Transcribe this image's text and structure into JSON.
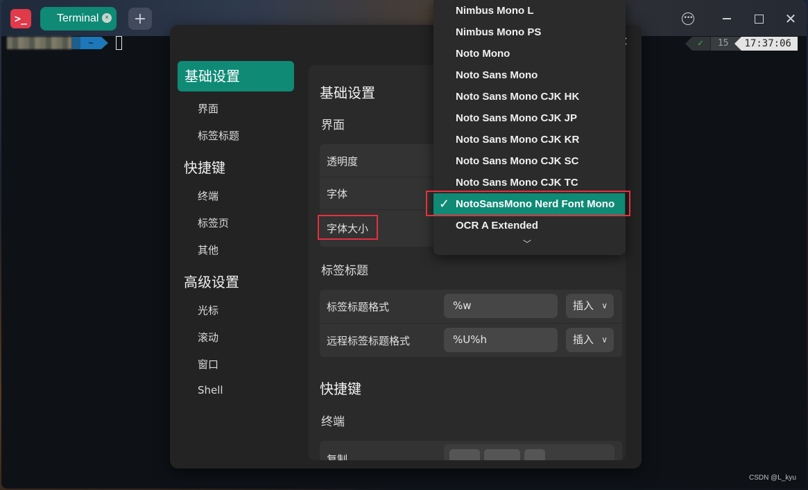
{
  "titlebar": {
    "app_icon_glyph": ">_",
    "tab_label": "Terminal",
    "tab_close": "×",
    "new_tab": "+",
    "menu_glyph": "•••",
    "close_glyph": "✕"
  },
  "terminal": {
    "dir_glyph": "~",
    "status_check": "✓",
    "history_number": "15",
    "time": "17:37:06"
  },
  "dialog": {
    "close_glyph": "✕",
    "sidebar": {
      "groups": [
        {
          "label": "基础设置",
          "items": [
            "界面",
            "标签标题"
          ]
        },
        {
          "label": "快捷键",
          "items": [
            "终端",
            "标签页",
            "其他"
          ]
        },
        {
          "label": "高级设置",
          "items": [
            "光标",
            "滚动",
            "窗口",
            "Shell"
          ]
        }
      ]
    },
    "content": {
      "section_basic": "基础设置",
      "sub_interface": "界面",
      "rows_interface": [
        "透明度",
        "字体",
        "字体大小"
      ],
      "sub_tab_title": "标签标题",
      "rows_tab_title": [
        {
          "label": "标签标题格式",
          "value": "%w",
          "insert": "插入"
        },
        {
          "label": "远程标签标题格式",
          "value": "%U%h",
          "insert": "插入"
        }
      ],
      "section_shortcuts": "快捷键",
      "sub_terminal": "终端",
      "row_copy": "复制"
    }
  },
  "font_dropdown": {
    "options": [
      "Nimbus Mono L",
      "Nimbus Mono PS",
      "Noto Mono",
      "Noto Sans Mono",
      "Noto Sans Mono CJK HK",
      "Noto Sans Mono CJK JP",
      "Noto Sans Mono CJK KR",
      "Noto Sans Mono CJK SC",
      "Noto Sans Mono CJK TC",
      "NotoSansMono Nerd Font Mono",
      "OCR A Extended"
    ],
    "selected": "NotoSansMono Nerd Font Mono",
    "check_glyph": "✓",
    "more_glyph": "﹀"
  },
  "watermark": "CSDN @L_kyu",
  "colors": {
    "accent": "#0f8a75",
    "highlight_box": "#e8303f",
    "app_icon": "#e13a4a"
  }
}
